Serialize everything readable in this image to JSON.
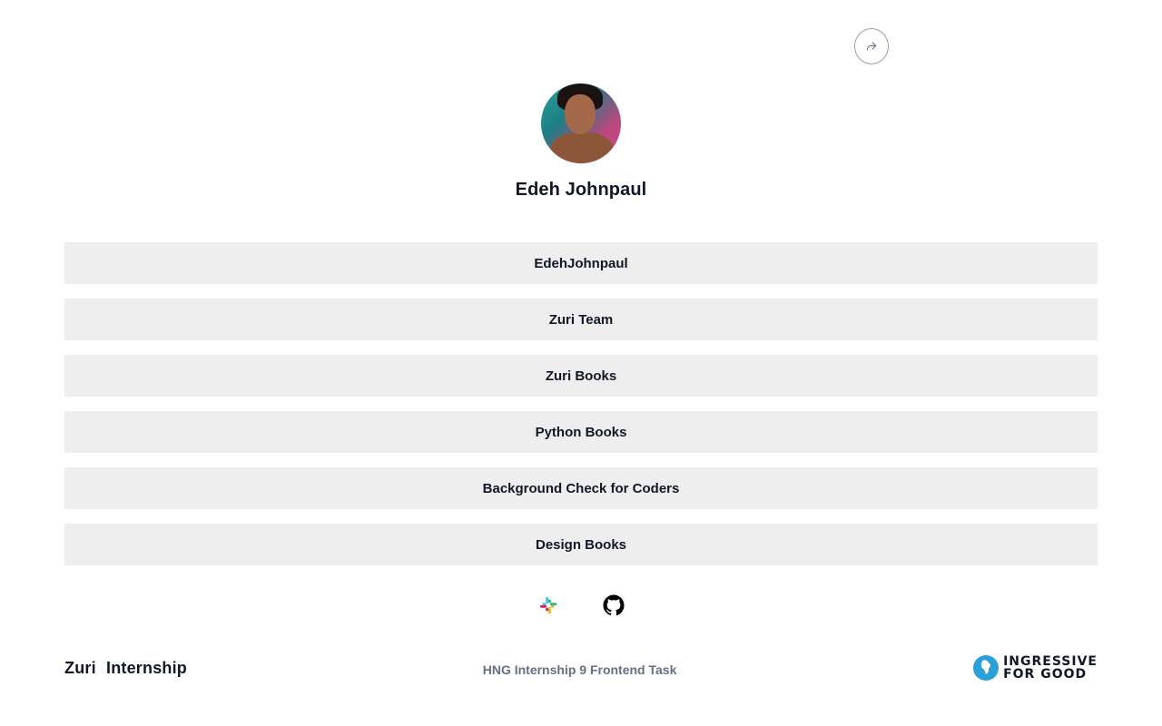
{
  "share": {
    "icon": "share-icon"
  },
  "profile": {
    "name": "Edeh Johnpaul",
    "avatar_alt": "profile-picture"
  },
  "links": [
    {
      "id": "twitter",
      "label": "EdehJohnpaul"
    },
    {
      "id": "btn__zuri",
      "label": "Zuri Team"
    },
    {
      "id": "books",
      "label": "Zuri Books"
    },
    {
      "id": "book__python",
      "label": "Python Books"
    },
    {
      "id": "pitch",
      "label": "Background Check for Coders"
    },
    {
      "id": "book__design",
      "label": "Design Books"
    }
  ],
  "socials": [
    {
      "name": "slack-icon"
    },
    {
      "name": "github-icon"
    }
  ],
  "footer": {
    "zuri_logo": "Zuri  Internship",
    "center_text": "HNG Internship 9 Frontend Task",
    "i4g_line1": "INGRESSIVE",
    "i4g_line2": "FOR GOOD"
  },
  "colors": {
    "link_bg": "#EEEEEE",
    "text": "#101828",
    "muted": "#667085",
    "border": "#98A2B3"
  }
}
